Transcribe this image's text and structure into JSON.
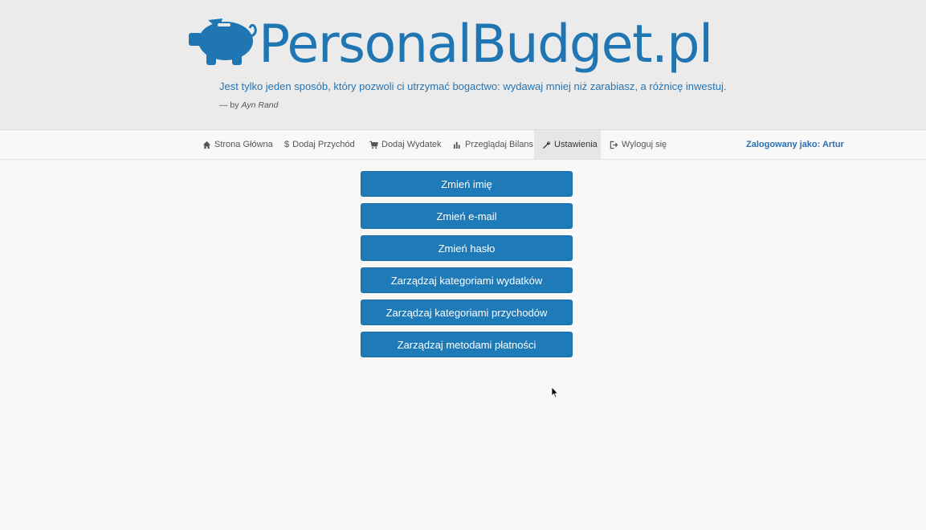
{
  "header": {
    "brand": "PersonalBudget.pl",
    "quote": "Jest tylko jeden sposób, który pozwoli ci utrzymać bogactwo: wydawaj mniej niż zarabiasz, a różnicę inwestuj.",
    "author_prefix": "— by",
    "author_name": "Ayn Rand",
    "logo_icon": "piggy-bank-icon",
    "brand_color": "#1f76b3"
  },
  "nav": {
    "items": [
      {
        "label": "Strona Główna",
        "icon": "home-icon"
      },
      {
        "label": "Dodaj Przychód",
        "icon": "dollar-icon"
      },
      {
        "label": "Dodaj Wydatek",
        "icon": "cart-icon"
      },
      {
        "label": "Przeglądaj Bilans",
        "icon": "bar-chart-icon"
      },
      {
        "label": "Ustawienia",
        "icon": "wrench-icon",
        "active": true
      },
      {
        "label": "Wyloguj się",
        "icon": "logout-icon"
      }
    ],
    "logged_in": "Zalogowany jako: Artur"
  },
  "settings": {
    "buttons": [
      "Zmień imię",
      "Zmień e-mail",
      "Zmień hasło",
      "Zarządzaj kategoriami wydatków",
      "Zarządzaj kategoriami przychodów",
      "Zarządzaj metodami płatności"
    ],
    "button_color": "#1f7ab8"
  }
}
